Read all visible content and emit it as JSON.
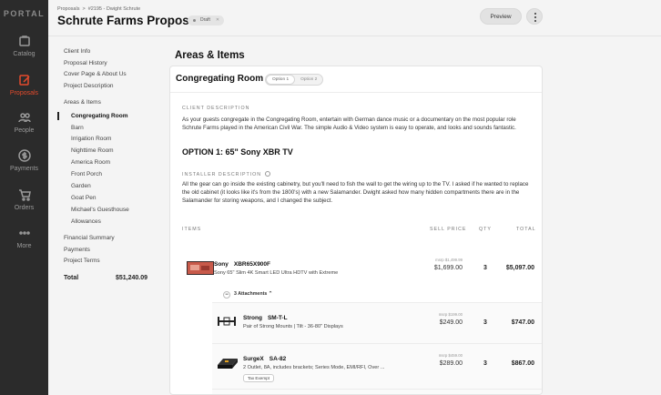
{
  "app": {
    "logo": "PORTAL"
  },
  "rail": {
    "items": [
      {
        "label": "Catalog",
        "icon": "catalog-icon"
      },
      {
        "label": "Proposals",
        "icon": "proposals-icon",
        "active": true
      },
      {
        "label": "People",
        "icon": "people-icon"
      },
      {
        "label": "Payments",
        "icon": "payments-icon"
      },
      {
        "label": "Orders",
        "icon": "orders-icon"
      },
      {
        "label": "More",
        "icon": "more-icon"
      }
    ]
  },
  "colors": {
    "accent": "#e54b2c",
    "rail_bg": "#2b2b2b"
  },
  "header": {
    "breadcrumb": [
      "Proposals",
      ">",
      "#2195 - Dwight Schrute"
    ],
    "title": "Schrute Farms Proposal",
    "status": "Draft",
    "status_x": "✕",
    "preview_label": "Preview"
  },
  "subnav": {
    "items": [
      "Client Info",
      "Proposal History",
      "Cover Page & About Us",
      "Project Description",
      "Areas & Items",
      "Congregating Room",
      "Barn",
      "Irrigation Room",
      "Nighttime Room",
      "America Room",
      "Front Porch",
      "Garden",
      "Goat Pen",
      "Michael's Guesthouse",
      "Allowances",
      "Financial Summary",
      "Payments",
      "Project Terms"
    ],
    "total_label": "Total",
    "total_value": "$51,240.09"
  },
  "main": {
    "section_heading": "Areas & Items",
    "room_title": "Congregating Room",
    "options": [
      "Option 1",
      "Option 2"
    ],
    "client_desc_label": "CLIENT DESCRIPTION",
    "client_desc": "As your guests congregate in the Congregating Room, entertain with German dance music or a documentary on the most popular role Schrute Farms played in the American Civil War. The simple Audio & Video system is easy to operate, and looks and sounds fantastic.",
    "option_title": "OPTION 1: 65\" Sony XBR TV",
    "installer_label": "INSTALLER DESCRIPTION",
    "installer_desc": "All the gear can go inside the existing cabinetry, but you'll need to fish the wall to get the wiring up to the TV. I asked if he wanted to replace the old cabinet (it looks like it's from the 1800's) with a new Salamander. Dwight asked how many hidden compartments there are in the Salamander for storing weapons, and I changed the subject.",
    "columns": {
      "items": "ITEMS",
      "sell_price": "SELL PRICE",
      "qty": "QTY",
      "total": "TOTAL"
    },
    "items": [
      {
        "brand": "Sony",
        "model": "XBR65X900F",
        "desc": "Sony 65\" Slim 4K Smart LED Ultra HDTV with Extreme",
        "msrp": "msrp $1,499.99",
        "price": "$1,699.00",
        "qty": "3",
        "total": "$5,097.00"
      }
    ],
    "attachments_label": "3 Attachments",
    "attachments": [
      {
        "brand": "Strong",
        "model": "SM-T-L",
        "desc": "Pair of Strong Mounts | Tilt - 36-80\" Displays",
        "msrp": "msrp $199.00",
        "price": "$249.00",
        "qty": "3",
        "total": "$747.00"
      },
      {
        "brand": "SurgeX",
        "model": "SA-82",
        "desc": "2 Outlet, 8A, includes brackets; Series Mode, EMI/RFI, Over ...",
        "msrp": "msrp $459.00",
        "price": "$289.00",
        "qty": "3",
        "total": "$867.00",
        "badge": "Tax Exempt"
      }
    ]
  }
}
